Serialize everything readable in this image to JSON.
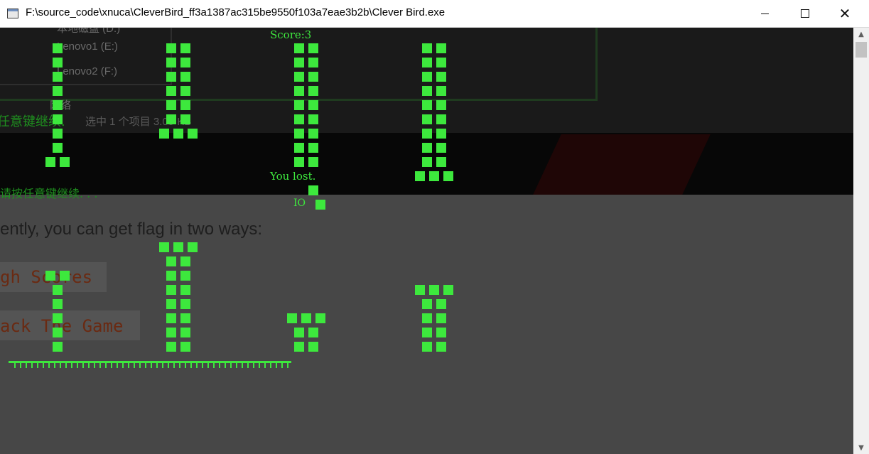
{
  "window": {
    "title": "F:\\source_code\\xnuca\\CleverBird_ff3a1387ac315be9550f103a7eae3b2b\\Clever Bird.exe",
    "controls": {
      "minimize": "—",
      "maximize": "☐",
      "close": "✕"
    }
  },
  "game": {
    "score_text": "Score:3",
    "lost_text": "You lost.",
    "bird_label": "IO",
    "colors": {
      "pixel": "#3de83d",
      "text": "#3ee83e",
      "background_top": "#070707",
      "background_bottom": "#474747"
    }
  },
  "ghost": {
    "drive_d": "本地磁盘 (D:)",
    "drive_e": "Lenovo1 (E:)",
    "drive_f": "Lenovo2 (F:)",
    "network": "网络",
    "press_key_partial": "任意键继续.",
    "status_bar": "选中 1 个项目 3.09 KB",
    "press_key": "请按任意键继续. . .",
    "intro_line": "ently, you can get flag in two ways:",
    "way_one": "gh Scores",
    "way_two": "ack The Game"
  },
  "scrollbar": {
    "up_icon": "▲",
    "down_icon": "▼"
  }
}
